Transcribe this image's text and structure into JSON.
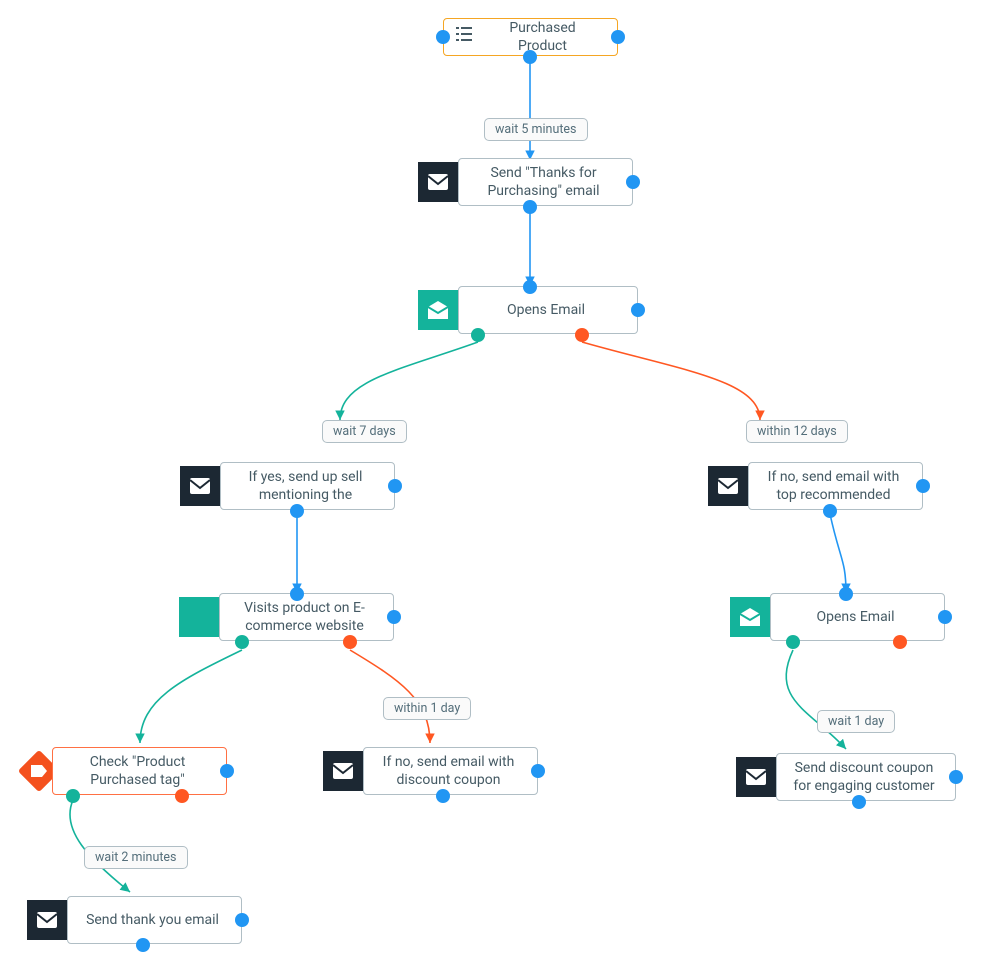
{
  "nodes": {
    "start": {
      "label": "Purchased Product"
    },
    "thanks": {
      "label": "Send \"Thanks for Purchasing\" email"
    },
    "opens1": {
      "label": "Opens Email"
    },
    "upsell": {
      "label": "If yes, send up sell mentioning the"
    },
    "norecom": {
      "label": "If no, send email with top recommended"
    },
    "visits": {
      "label": "Visits product on E-commerce website"
    },
    "opens2": {
      "label": "Opens Email"
    },
    "checktag": {
      "label": "Check \"Product Purchased tag\""
    },
    "discount": {
      "label": "If no, send email with discount coupon"
    },
    "engage": {
      "label": "Send discount coupon for engaging customer"
    },
    "thankyou": {
      "label": "Send thank you email"
    }
  },
  "pills": {
    "wait5m": "wait 5 minutes",
    "wait7d": "wait 7 days",
    "within12": "within 12 days",
    "within1d": "within 1 day",
    "wait1d": "wait 1 day",
    "wait2m": "wait 2 minutes"
  },
  "colors": {
    "blue": "#2196f3",
    "green": "#14b39b",
    "red": "#ff5722",
    "orange": "#f5a623",
    "dark": "#1c2833"
  }
}
